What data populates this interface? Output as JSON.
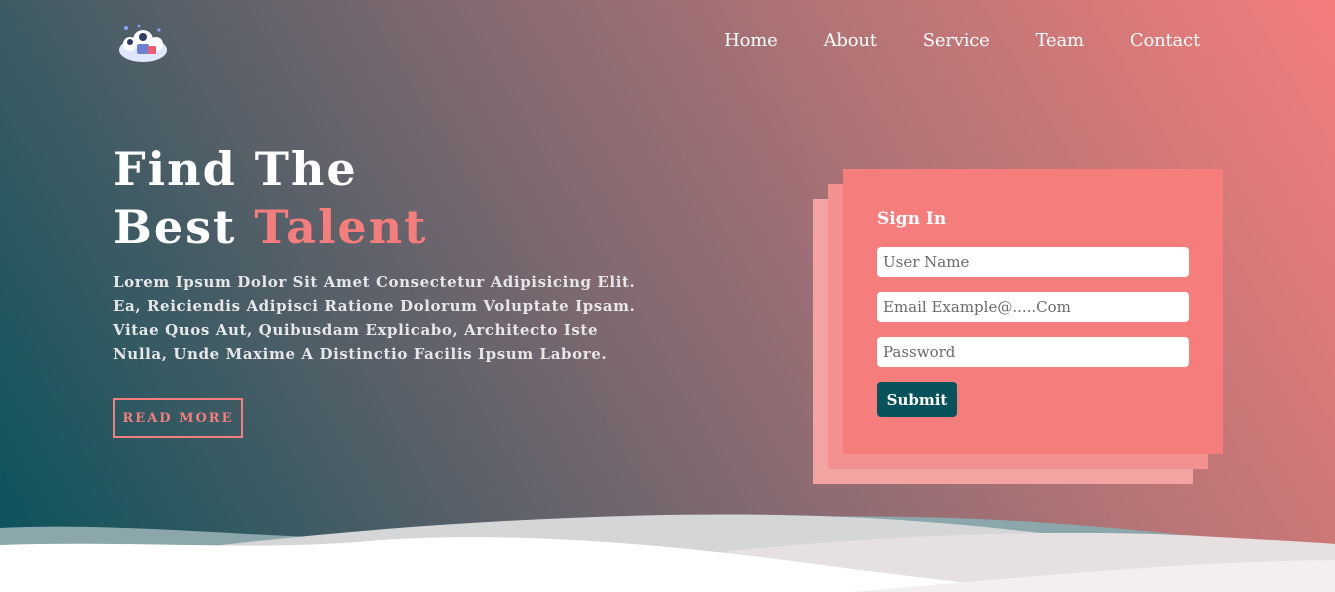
{
  "header": {
    "logo_icon": "team-illustration-logo",
    "nav": [
      {
        "label": "Home"
      },
      {
        "label": "About"
      },
      {
        "label": "Service"
      },
      {
        "label": "Team"
      },
      {
        "label": "Contact"
      }
    ]
  },
  "hero": {
    "title_line1": "Find The",
    "title_line2_plain": "Best ",
    "title_line2_accent": "Talent",
    "description": "Lorem Ipsum Dolor Sit Amet Consectetur Adipisicing Elit. Ea, Reiciendis Adipisci Ratione Dolorum Voluptate Ipsam. Vitae Quos Aut, Quibusdam Explicabo, Architecto Iste Nulla, Unde Maxime A Distinctio Facilis Ipsum Labore.",
    "read_more_label": "READ MORE"
  },
  "signin": {
    "title": "Sign In",
    "username_placeholder": "User Name",
    "email_placeholder": "Email Example@.....Com",
    "password_placeholder": "Password",
    "submit_label": "Submit"
  },
  "colors": {
    "accent": "#f57d7c",
    "dark_teal": "#07525b"
  }
}
